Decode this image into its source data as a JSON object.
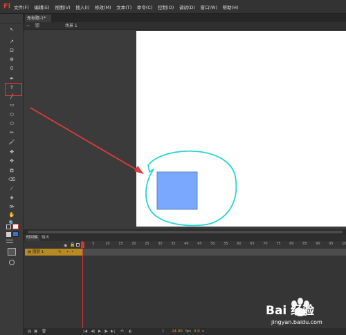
{
  "app": {
    "logo": "Fl"
  },
  "menubar": {
    "items": [
      "文件(F)",
      "编辑(E)",
      "视图(V)",
      "插入(I)",
      "修改(M)",
      "文本(T)",
      "命令(C)",
      "控制(O)",
      "调试(D)",
      "窗口(W)",
      "帮助(H)"
    ]
  },
  "document": {
    "tab_label": "无标题-1*",
    "scene_label": "场景 1"
  },
  "tools": [
    {
      "name": "selection-tool-icon",
      "glyph": "↖"
    },
    {
      "name": "subselection-tool-icon",
      "glyph": "↗"
    },
    {
      "name": "free-transform-tool-icon",
      "glyph": "⊡"
    },
    {
      "name": "3d-rotation-tool-icon",
      "glyph": "⊕"
    },
    {
      "name": "lasso-tool-icon",
      "glyph": "ᘓ"
    },
    {
      "name": "pen-tool-icon",
      "glyph": "✒"
    },
    {
      "name": "text-tool-icon",
      "glyph": "T"
    },
    {
      "name": "line-tool-icon",
      "glyph": "╱"
    },
    {
      "name": "rectangle-tool-icon",
      "glyph": "▭"
    },
    {
      "name": "oval-tool-icon",
      "glyph": "⬭"
    },
    {
      "name": "polystar-tool-icon",
      "glyph": "⬭"
    },
    {
      "name": "pencil-tool-icon",
      "glyph": "✏"
    },
    {
      "name": "brush-tool-icon",
      "glyph": "🖌"
    },
    {
      "name": "deco-tool-icon",
      "glyph": "✤"
    },
    {
      "name": "bone-tool-icon",
      "glyph": "✥"
    },
    {
      "name": "paint-bucket-icon",
      "glyph": "⛾"
    },
    {
      "name": "ink-bottle-icon",
      "glyph": "⌫"
    },
    {
      "name": "eyedropper-icon",
      "glyph": "⁄"
    },
    {
      "name": "eraser-tool-icon",
      "glyph": "◈"
    },
    {
      "name": "width-tool-icon",
      "glyph": "≫"
    },
    {
      "name": "hand-tool-icon",
      "glyph": "✋"
    },
    {
      "name": "zoom-tool-icon",
      "glyph": "🔍"
    }
  ],
  "timeline": {
    "tab_timeline": "时间轴",
    "tab_output": "输出",
    "ruler_ticks": [
      "1",
      "5",
      "10",
      "15",
      "20",
      "25",
      "30",
      "35",
      "40",
      "45",
      "50",
      "55",
      "60",
      "65",
      "70",
      "75",
      "80",
      "85",
      "90",
      "95",
      "100"
    ],
    "layer_name": "图层 1",
    "current_frame": "1",
    "fps": "24.00",
    "fps_unit": "fps",
    "elapsed": "0.0",
    "elapsed_unit": "s"
  },
  "watermark": {
    "brand": "Bai 经验",
    "url": "jingyan.baidu.com"
  },
  "colors": {
    "annotation_red": "#e33a3a",
    "shape_fill": "#7aa8ff",
    "shape_stroke": "#5b80cc",
    "freehand_circle": "#26d4d4",
    "layer_row": "#b88b22"
  }
}
